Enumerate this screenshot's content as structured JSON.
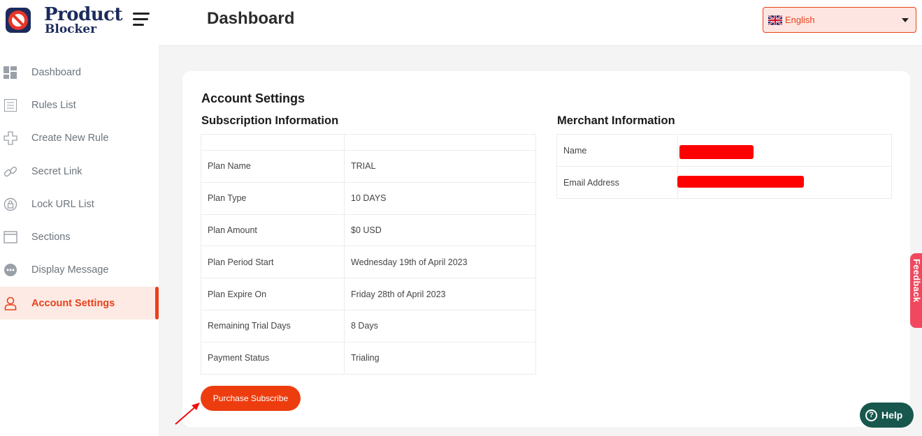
{
  "brand": {
    "name": "Product",
    "sub": "Blocker"
  },
  "header": {
    "title": "Dashboard",
    "language": "English"
  },
  "sidebar": {
    "items": [
      {
        "label": "Dashboard",
        "icon": "dashboard-grid-icon"
      },
      {
        "label": "Rules List",
        "icon": "list-icon"
      },
      {
        "label": "Create New Rule",
        "icon": "plus-icon"
      },
      {
        "label": "Secret Link",
        "icon": "link-icon"
      },
      {
        "label": "Lock URL List",
        "icon": "lock-url-icon"
      },
      {
        "label": "Sections",
        "icon": "window-icon"
      },
      {
        "label": "Display Message",
        "icon": "chat-dots-icon"
      },
      {
        "label": "Account Settings",
        "icon": "user-icon",
        "active": true
      }
    ]
  },
  "main": {
    "card_title": "Account Settings",
    "subscription": {
      "title": "Subscription Information",
      "rows": [
        {
          "label": "Plan Name",
          "value": "TRIAL"
        },
        {
          "label": "Plan Type",
          "value": "10 DAYS"
        },
        {
          "label": "Plan Amount",
          "value": "$0 USD"
        },
        {
          "label": "Plan Period Start",
          "value": "Wednesday 19th of April 2023"
        },
        {
          "label": "Plan Expire On",
          "value": "Friday 28th of April 2023"
        },
        {
          "label": "Remaining Trial Days",
          "value": "8 Days"
        },
        {
          "label": "Payment Status",
          "value": "Trialing"
        }
      ]
    },
    "merchant": {
      "title": "Merchant Information",
      "rows": [
        {
          "label": "Name"
        },
        {
          "label": "Email Address"
        }
      ]
    },
    "purchase_button": "Purchase Subscribe"
  },
  "feedback_label": "Feedback",
  "help": {
    "icon_glyph": "?",
    "label": "Help"
  },
  "colors": {
    "accent": "#ed3d0e",
    "brand": "#1c2b5c",
    "help": "#17574d",
    "feedback": "#f0485e",
    "redaction": "#ff0000"
  }
}
